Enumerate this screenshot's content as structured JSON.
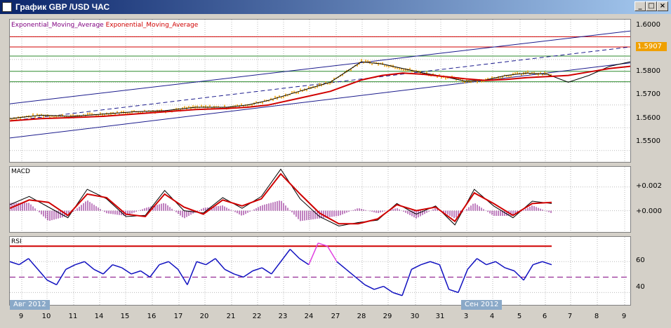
{
  "window": {
    "title": "График GBP /USD  ЧАС",
    "buttons": [
      "_",
      "□",
      "×"
    ]
  },
  "price_badge": "1.5907",
  "chart_data": [
    {
      "type": "line",
      "name": "price",
      "legend": [
        "Exponential_Moving_Average",
        "Exponential_Moving_Average"
      ],
      "yticks": [
        "1.6000",
        "1.5900",
        "1.5800",
        "1.5700",
        "1.5600",
        "1.5500"
      ],
      "ylim": [
        1.545,
        1.6075
      ],
      "xlim": [
        9,
        9.6
      ],
      "grid": true,
      "colors": {
        "price": "#f0a000",
        "ema_fast": "#000000",
        "ema_slow": "#d00000",
        "channel": "#1a1a8c",
        "support": "#2e8b2e",
        "resistance": "#d00000"
      },
      "horizontal_red": [
        1.6,
        1.5955
      ],
      "horizontal_green": [
        1.5915,
        1.5848,
        1.5802
      ],
      "channel_upper": [
        [
          9.0,
          1.5705
        ],
        [
          9.6,
          1.6025
        ]
      ],
      "channel_lower": [
        [
          9.0,
          1.5555
        ],
        [
          9.6,
          1.5885
        ]
      ],
      "channel_mid_dashed": [
        [
          9.0,
          1.563
        ],
        [
          9.6,
          1.5955
        ]
      ],
      "ema_slow": [
        [
          9.0,
          1.563
        ],
        [
          9.03,
          1.564
        ],
        [
          9.06,
          1.5645
        ],
        [
          9.09,
          1.565
        ],
        [
          9.12,
          1.566
        ],
        [
          9.15,
          1.567
        ],
        [
          9.18,
          1.568
        ],
        [
          9.21,
          1.5685
        ],
        [
          9.23,
          1.569
        ],
        [
          9.25,
          1.57
        ],
        [
          9.28,
          1.573
        ],
        [
          9.31,
          1.576
        ],
        [
          9.34,
          1.581
        ],
        [
          9.36,
          1.583
        ],
        [
          9.38,
          1.584
        ],
        [
          9.4,
          1.5835
        ],
        [
          9.42,
          1.5825
        ],
        [
          9.44,
          1.5815
        ],
        [
          9.46,
          1.5808
        ],
        [
          9.48,
          1.5812
        ],
        [
          9.5,
          1.582
        ],
        [
          9.52,
          1.5825
        ],
        [
          9.54,
          1.583
        ],
        [
          9.56,
          1.5845
        ],
        [
          9.58,
          1.586
        ],
        [
          9.6,
          1.587
        ],
        [
          9.62,
          1.5875
        ],
        [
          9.64,
          1.588
        ],
        [
          9.66,
          1.589
        ]
      ],
      "ema_fast": [
        [
          9.0,
          1.564
        ],
        [
          9.03,
          1.5655
        ],
        [
          9.06,
          1.565
        ],
        [
          9.09,
          1.566
        ],
        [
          9.12,
          1.567
        ],
        [
          9.15,
          1.5675
        ],
        [
          9.18,
          1.569
        ],
        [
          9.21,
          1.569
        ],
        [
          9.23,
          1.57
        ],
        [
          9.25,
          1.572
        ],
        [
          9.28,
          1.576
        ],
        [
          9.31,
          1.58
        ],
        [
          9.34,
          1.589
        ],
        [
          9.36,
          1.588
        ],
        [
          9.38,
          1.586
        ],
        [
          9.4,
          1.584
        ],
        [
          9.42,
          1.5825
        ],
        [
          9.44,
          1.5805
        ],
        [
          9.46,
          1.581
        ],
        [
          9.48,
          1.583
        ],
        [
          9.5,
          1.584
        ],
        [
          9.52,
          1.5835
        ],
        [
          9.54,
          1.58
        ],
        [
          9.56,
          1.583
        ],
        [
          9.58,
          1.587
        ],
        [
          9.6,
          1.589
        ],
        [
          9.62,
          1.5895
        ],
        [
          9.64,
          1.5885
        ],
        [
          9.66,
          1.5905
        ]
      ]
    },
    {
      "type": "line",
      "name": "MACD",
      "label": "MACD",
      "yticks": [
        "+0.002",
        "+0.000"
      ],
      "ylim": [
        -0.0018,
        0.0037
      ],
      "zero_line": 0,
      "colors": {
        "macd": "#000000",
        "signal": "#d00000",
        "histogram": "#800080"
      },
      "macd": [
        0.0005,
        0.0012,
        0.0003,
        -0.0006,
        0.0018,
        0.001,
        -0.0005,
        -0.0004,
        0.0017,
        0.0,
        -0.0002,
        0.0011,
        0.0002,
        0.0012,
        0.0035,
        0.001,
        -0.0005,
        -0.0013,
        -0.001,
        -0.0008,
        0.0006,
        -0.0003,
        0.0004,
        -0.0012,
        0.0018,
        0.0004,
        -0.0006,
        0.0008,
        0.0006
      ],
      "signal": [
        0.0002,
        0.0009,
        0.0007,
        -0.0004,
        0.0014,
        0.0011,
        -0.0003,
        -0.0005,
        0.0014,
        0.0003,
        -0.0003,
        0.0009,
        0.0004,
        0.001,
        0.0031,
        0.0014,
        -0.0002,
        -0.0011,
        -0.0011,
        -0.0007,
        0.0005,
        0.0,
        0.0003,
        -0.0009,
        0.0015,
        0.0006,
        -0.0004,
        0.0006,
        0.0007
      ]
    },
    {
      "type": "line",
      "name": "RSI",
      "label": "RSI",
      "yticks": [
        "60",
        "40"
      ],
      "ylim": [
        32,
        76
      ],
      "overbought": 70,
      "oversold": 30,
      "mid": 50,
      "colors": {
        "rsi": "#1010c0",
        "rsi_extreme": "#e040e0",
        "overbought": "#d00000",
        "oversold": "#008000",
        "mid": "#800080"
      },
      "values": [
        60,
        58,
        62,
        55,
        48,
        45,
        55,
        58,
        60,
        55,
        52,
        58,
        56,
        52,
        54,
        50,
        58,
        60,
        55,
        45,
        60,
        58,
        62,
        55,
        52,
        50,
        54,
        56,
        52,
        60,
        68,
        62,
        58,
        72,
        70,
        60,
        55,
        50,
        45,
        42,
        44,
        40,
        38,
        55,
        58,
        60,
        58,
        42,
        40,
        55,
        62,
        58,
        60,
        56,
        54,
        48,
        58,
        60,
        58
      ]
    }
  ],
  "x_axis": {
    "ticks": [
      "9",
      "10",
      "11",
      "14",
      "15",
      "16",
      "17",
      "20",
      "21",
      "22",
      "23",
      "24",
      "27",
      "28",
      "29",
      "30",
      "31",
      "3",
      "4",
      "5",
      "6",
      "7",
      "8",
      "9"
    ],
    "months": [
      "Авг 2012",
      "Сен 2012"
    ]
  }
}
